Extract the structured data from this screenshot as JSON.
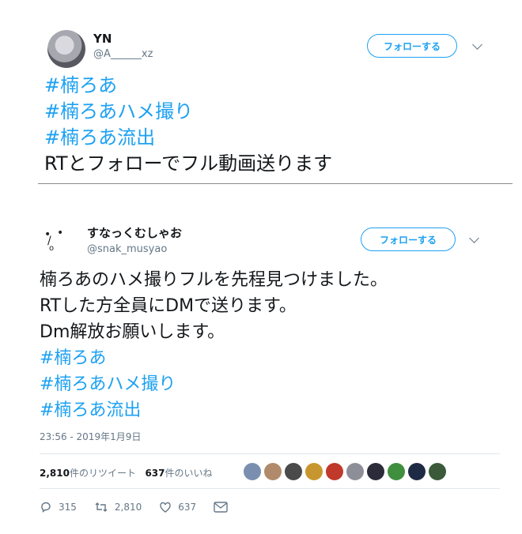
{
  "tweet1": {
    "name": "YN",
    "handle": "@A______xz",
    "follow_label": "フォローする",
    "lines": [
      {
        "text": "#楠ろあ",
        "hashtag": true
      },
      {
        "text": "#楠ろあハメ撮り",
        "hashtag": true
      },
      {
        "text": "#楠ろあ流出",
        "hashtag": true
      },
      {
        "text": "RTとフォローでフル動画送ります",
        "hashtag": false
      }
    ]
  },
  "tweet2": {
    "name": "すなっくむしゃお",
    "handle": "@snak_musyao",
    "follow_label": "フォローする",
    "lines": [
      {
        "text": "楠ろあのハメ撮りフルを先程見つけました。",
        "hashtag": false
      },
      {
        "text": "RTした方全員にDMで送ります。",
        "hashtag": false
      },
      {
        "text": "Dm解放お願いします。",
        "hashtag": false
      },
      {
        "text": "#楠ろあ",
        "hashtag": true
      },
      {
        "text": "#楠ろあハメ撮り",
        "hashtag": true
      },
      {
        "text": "#楠ろあ流出",
        "hashtag": true
      }
    ],
    "timestamp": "23:56 - 2019年1月9日",
    "retweets_count": "2,810",
    "retweets_label": "件のリツイート",
    "likes_count": "637",
    "likes_label": "件のいいね",
    "liker_colors": [
      "#7a8fb0",
      "#b08a6a",
      "#4a4a4a",
      "#c8962e",
      "#c0392b",
      "#8e8e99",
      "#2b2b3a",
      "#3f8f3f",
      "#1f2a44",
      "#3a5a3a"
    ],
    "actions": {
      "replies": "315",
      "retweets": "2,810",
      "likes": "637"
    }
  },
  "colors": {
    "accent": "#1da1f2",
    "muted": "#657786",
    "text": "#14171a"
  }
}
